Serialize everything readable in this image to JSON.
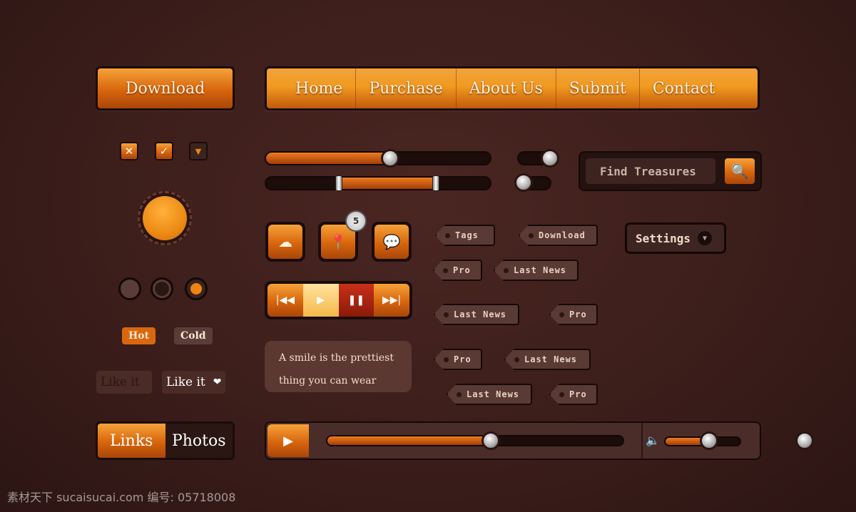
{
  "download_button": {
    "label": "Download"
  },
  "nav": {
    "items": [
      {
        "label": "Home"
      },
      {
        "label": "Purchase"
      },
      {
        "label": "About Us"
      },
      {
        "label": "Submit"
      },
      {
        "label": "Contact"
      }
    ]
  },
  "checkboxes": [
    {
      "icon": "close-icon",
      "glyph": "✕"
    },
    {
      "icon": "check-icon",
      "glyph": "✓"
    },
    {
      "icon": "dropdown-icon",
      "glyph": "▼"
    }
  ],
  "radios": [
    "off",
    "off-dark",
    "selected"
  ],
  "bubbles": {
    "hot": "Hot",
    "cold": "Cold"
  },
  "like": {
    "label_off": "Like it",
    "label_on": "Like it",
    "heart": "❤"
  },
  "sliders": {
    "single_value_pct": 50,
    "range_pct": [
      28,
      66
    ]
  },
  "toggles": [
    {
      "state": "on"
    },
    {
      "state": "off"
    }
  ],
  "search": {
    "placeholder": "Find Treasures",
    "icon": "🔍"
  },
  "icon_buttons": [
    {
      "icon": "cloud-icon",
      "glyph": "☁"
    },
    {
      "icon": "map-pin-icon",
      "glyph": "📍",
      "badge": "5"
    },
    {
      "icon": "chat-icon",
      "glyph": "💬"
    }
  ],
  "player": {
    "prev": "|◀◀",
    "play": "▶",
    "pause": "❚❚",
    "next": "▶▶|"
  },
  "quote": {
    "line1": "A smile is the prettiest",
    "line2": "thing you can wear"
  },
  "tags": [
    "Tags",
    "Download",
    "Pro",
    "Last News",
    "Last News",
    "Pro",
    "Pro",
    "Last News",
    "Last News",
    "Pro"
  ],
  "settings": {
    "label": "Settings",
    "caret": "▼"
  },
  "segmented": {
    "links": "Links",
    "photos": "Photos"
  },
  "media_bar": {
    "play": "▶",
    "progress_pct": 60,
    "volume_pct": 60,
    "volume_icon": "🔈"
  },
  "watermark": "素材天下 sucaisucai.com  编号: 05718008",
  "colors": {
    "accent": "#f09a20",
    "leather": "#3a1d1a"
  }
}
